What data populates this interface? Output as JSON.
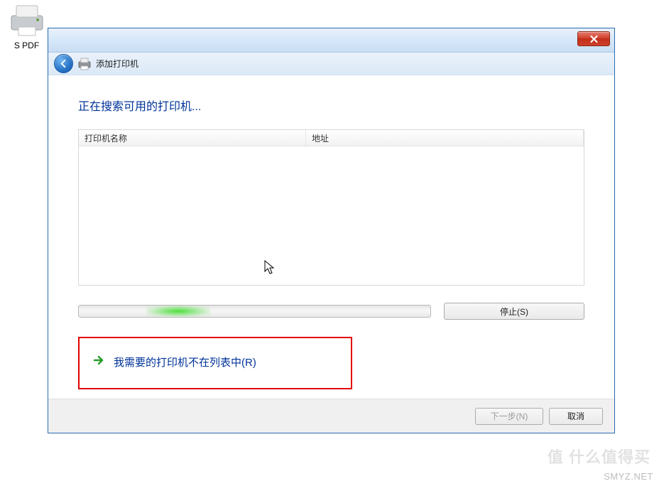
{
  "desktop": {
    "icon_label": "S PDF"
  },
  "dialog": {
    "nav_title": "添加打印机",
    "heading": "正在搜索可用的打印机...",
    "columns": {
      "name": "打印机名称",
      "address": "地址"
    },
    "stop_button": "停止(S)",
    "not_listed": "我需要的打印机不在列表中(R)",
    "next_button": "下一步(N)",
    "cancel_button": "取消"
  },
  "watermark": {
    "cn": "值 什么值得买",
    "en": "SMYZ.NET"
  }
}
